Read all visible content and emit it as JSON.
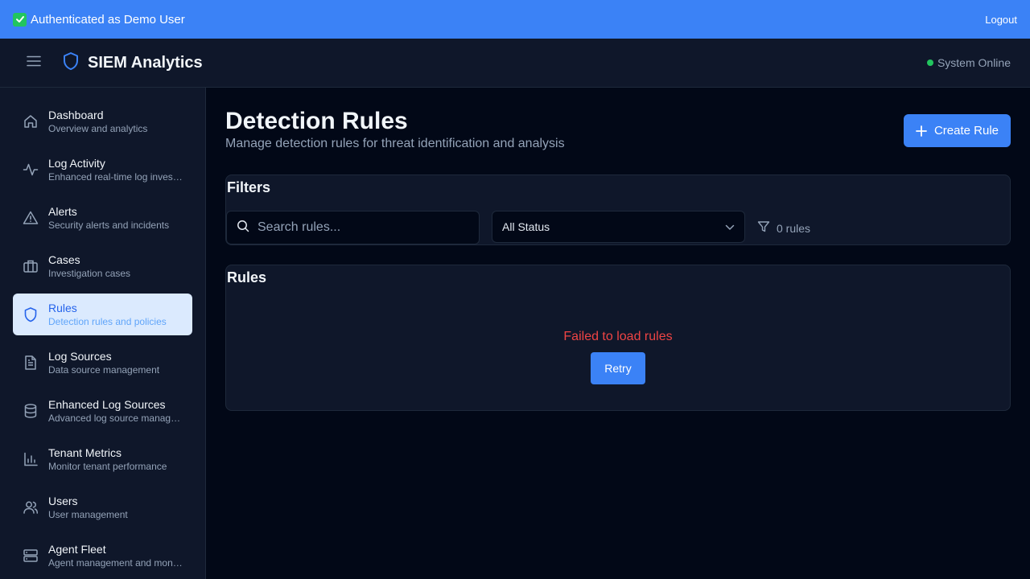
{
  "auth_bar": {
    "message": "Authenticated as Demo User",
    "logout_label": "Logout",
    "background": "#3b82f6"
  },
  "header": {
    "app_title": "SIEM Analytics",
    "status_text": "System Online",
    "status_color": "#22c55e"
  },
  "sidebar": {
    "items": [
      {
        "label": "Dashboard",
        "desc": "Overview and analytics",
        "icon": "home-icon",
        "active": false
      },
      {
        "label": "Log Activity",
        "desc": "Enhanced real-time log investigation",
        "icon": "activity-icon",
        "active": false
      },
      {
        "label": "Alerts",
        "desc": "Security alerts and incidents",
        "icon": "alert-triangle-icon",
        "active": false
      },
      {
        "label": "Cases",
        "desc": "Investigation cases",
        "icon": "briefcase-icon",
        "active": false
      },
      {
        "label": "Rules",
        "desc": "Detection rules and policies",
        "icon": "shield-icon",
        "active": true
      },
      {
        "label": "Log Sources",
        "desc": "Data source management",
        "icon": "file-text-icon",
        "active": false
      },
      {
        "label": "Enhanced Log Sources",
        "desc": "Advanced log source management",
        "icon": "database-icon",
        "active": false
      },
      {
        "label": "Tenant Metrics",
        "desc": "Monitor tenant performance",
        "icon": "bar-chart-icon",
        "active": false
      },
      {
        "label": "Users",
        "desc": "User management",
        "icon": "users-icon",
        "active": false
      },
      {
        "label": "Agent Fleet",
        "desc": "Agent management and monitoring",
        "icon": "server-icon",
        "active": false
      }
    ]
  },
  "main": {
    "title": "Detection Rules",
    "subtitle": "Manage detection rules for threat identification and analysis",
    "create_button_label": "Create Rule",
    "filters": {
      "title": "Filters",
      "search_placeholder": "Search rules...",
      "search_value": "",
      "status_selected": "All Status",
      "count_text": "0 rules"
    },
    "rules": {
      "title": "Rules",
      "error_text": "Failed to load rules",
      "retry_label": "Retry"
    }
  },
  "colors": {
    "accent": "#3b82f6",
    "error": "#ef4444",
    "background": "#020817",
    "panel": "#0f172a",
    "active_nav_bg": "#dbeafe"
  }
}
